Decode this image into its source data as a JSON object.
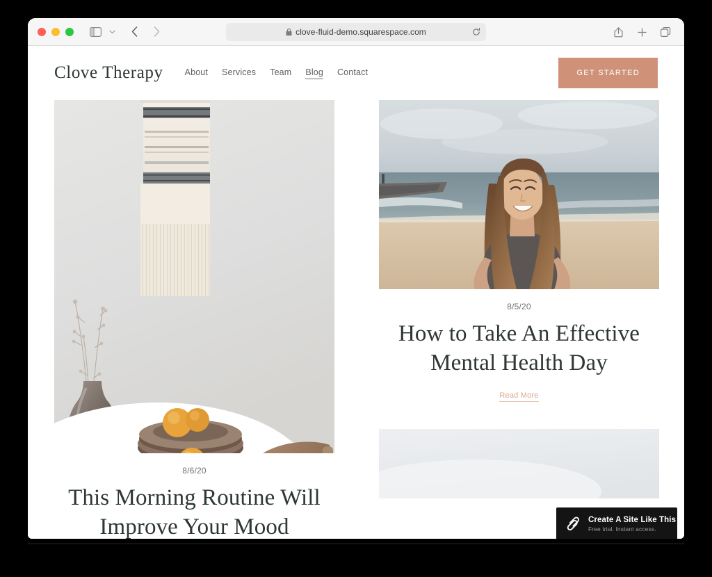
{
  "browser": {
    "window_controls": [
      "close",
      "minimize",
      "maximize"
    ],
    "sidebar_icon": "sidebar-icon",
    "chevron_icon": "chevron-down-icon",
    "back_icon": "chevron-left-icon",
    "forward_icon": "chevron-right-icon",
    "url": "clove-fluid-demo.squarespace.com",
    "lock_icon": "lock-icon",
    "reload_icon": "reload-icon",
    "share_icon": "share-icon",
    "new_tab_icon": "plus-icon",
    "tabs_icon": "tab-overview-icon"
  },
  "site": {
    "logo": "Clove Therapy",
    "nav": [
      {
        "label": "About",
        "active": false
      },
      {
        "label": "Services",
        "active": false
      },
      {
        "label": "Team",
        "active": false
      },
      {
        "label": "Blog",
        "active": true
      },
      {
        "label": "Contact",
        "active": false
      }
    ],
    "cta_label": "GET STARTED",
    "accent_color": "#cf9279",
    "link_color": "#dba78e",
    "heading_color": "#2e3733"
  },
  "blog": {
    "left_column": [
      {
        "image_name": "woven-wall-hanging-dining-table-photo",
        "date": "8/6/20",
        "title": "This Morning Routine Will Improve Your Mood"
      }
    ],
    "right_column": [
      {
        "image_name": "smiling-woman-on-beach-photo",
        "date": "8/5/20",
        "title": "How to Take An Effective Mental Health Day",
        "read_more": "Read More"
      },
      {
        "image_name": "pale-gray-photo"
      }
    ]
  },
  "badge": {
    "logo_icon": "squarespace-logo-icon",
    "title": "Create A Site Like This",
    "subtitle": "Free trial. Instant access."
  }
}
